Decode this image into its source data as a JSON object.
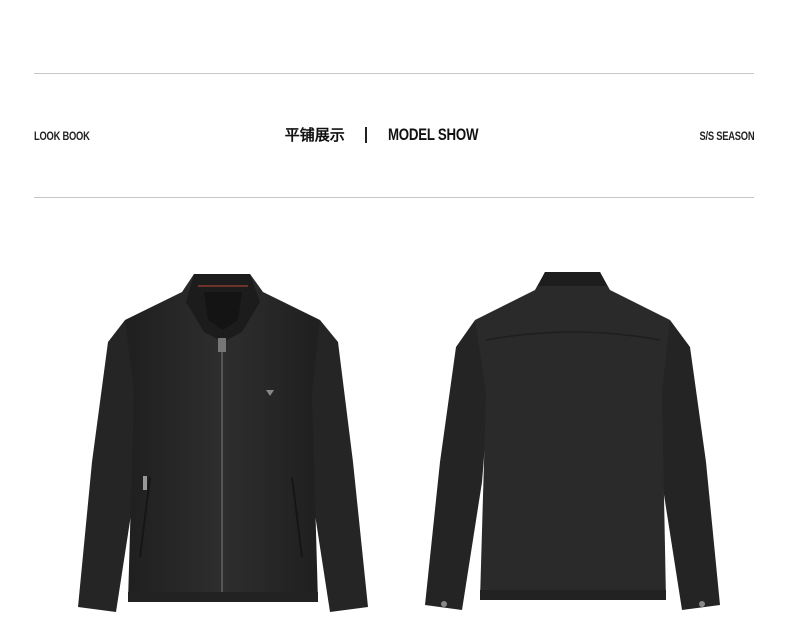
{
  "header": {
    "left_label": "LOOK BOOK",
    "title_cn": "平铺展示",
    "title_en": "MODEL SHOW",
    "right_label": "S/S SEASON"
  },
  "images": [
    {
      "name": "jacket-front-image",
      "view": "front"
    },
    {
      "name": "jacket-back-image",
      "view": "back"
    }
  ],
  "colors": {
    "background": "#ffffff",
    "rule": "#c8c8c8",
    "text": "#1a1a1a",
    "jacket": "#2b2b2b"
  }
}
